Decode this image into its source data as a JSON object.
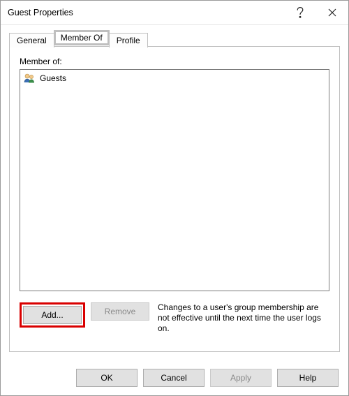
{
  "window": {
    "title": "Guest Properties"
  },
  "tabs": {
    "general": "General",
    "memberof": "Member Of",
    "profile": "Profile",
    "active": "memberof"
  },
  "panel": {
    "label": "Member of:",
    "groups": [
      {
        "name": "Guests"
      }
    ],
    "add_label": "Add...",
    "remove_label": "Remove",
    "note": "Changes to a user's group membership are not effective until the next time the user logs on."
  },
  "footer": {
    "ok": "OK",
    "cancel": "Cancel",
    "apply": "Apply",
    "help": "Help"
  }
}
